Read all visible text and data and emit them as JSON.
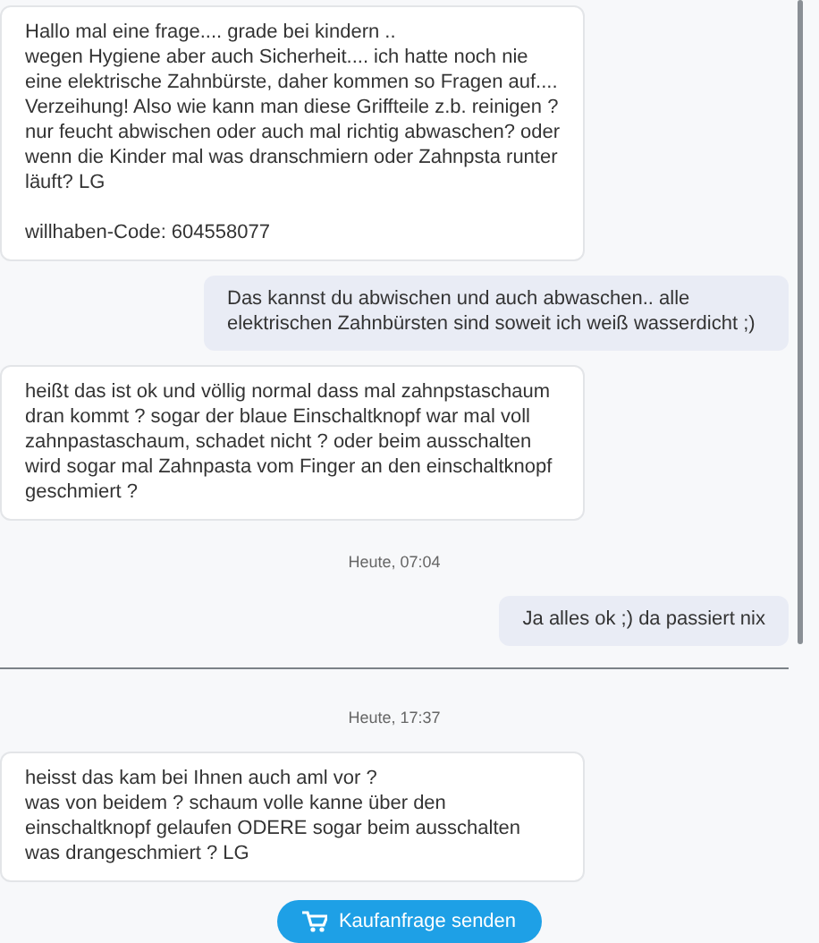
{
  "messages": [
    {
      "kind": "message",
      "outgoing": false,
      "text": "Hallo mal eine frage.... grade bei kindern ..\nwegen Hygiene aber auch Sicherheit.... ich hatte noch nie eine elektrische Zahnbürste, daher kommen so Fragen auf.... Verzeihung! Also wie kann man diese Griffteile z.b. reinigen ? nur feucht abwischen oder auch mal richtig abwaschen? oder wenn die Kinder mal was dranschmiern oder Zahnpsta runter läuft? LG\n\nwillhaben-Code: 604558077"
    },
    {
      "kind": "message",
      "outgoing": true,
      "text": "Das kannst du abwischen und auch abwaschen.. alle elektrischen Zahnbürsten sind soweit ich weiß wasserdicht ;)"
    },
    {
      "kind": "message",
      "outgoing": false,
      "text": "heißt das ist ok und völlig normal dass mal zahnpstaschaum dran kommt ? sogar der blaue Einschaltknopf war mal voll zahnpastaschaum, schadet nicht ? oder beim ausschalten wird sogar mal Zahnpasta vom Finger an den einschaltknopf geschmiert ?"
    },
    {
      "kind": "timestamp",
      "text": "Heute, 07:04"
    },
    {
      "kind": "message",
      "outgoing": true,
      "text": "Ja alles ok ;) da passiert nix"
    },
    {
      "kind": "divider"
    },
    {
      "kind": "timestamp",
      "text": "Heute, 17:37"
    },
    {
      "kind": "message",
      "outgoing": false,
      "text": "heisst das kam bei Ihnen auch aml vor ?\nwas von beidem ? schaum volle kanne über den einschaltknopf gelaufen ODERE sogar beim ausschalten was drangeschmiert ? LG"
    }
  ],
  "action_button": {
    "label": "Kaufanfrage senden"
  }
}
